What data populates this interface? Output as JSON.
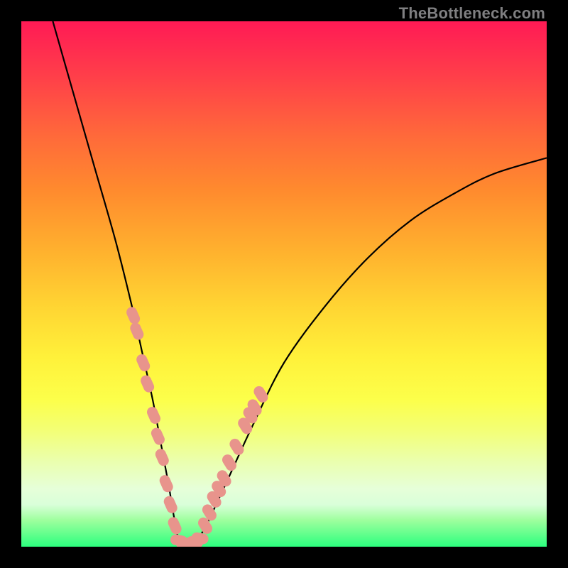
{
  "attribution": "TheBottleneck.com",
  "colors": {
    "frame": "#000000",
    "attribution_text": "#7f7f81",
    "curve": "#000000",
    "dot": "#e8948c",
    "gradient_top": "#ff1a55",
    "gradient_bottom": "#2cff7e"
  },
  "chart_data": {
    "type": "line",
    "title": "",
    "xlabel": "",
    "ylabel": "",
    "xlim": [
      0,
      100
    ],
    "ylim": [
      0,
      100
    ],
    "grid": false,
    "legend": false,
    "series": [
      {
        "name": "bottleneck-curve",
        "x": [
          6,
          10,
          14,
          18,
          21,
          23,
          25,
          26.5,
          28,
          29,
          30,
          31,
          34,
          38,
          44,
          50,
          58,
          66,
          74,
          82,
          90,
          100
        ],
        "values": [
          100,
          86,
          72,
          58,
          46,
          37,
          28,
          20,
          12,
          6,
          1,
          0,
          2,
          10,
          23,
          35,
          46,
          55,
          62,
          67,
          71,
          74
        ]
      }
    ],
    "highlighted_points_left": [
      {
        "x": 21.3,
        "y": 44
      },
      {
        "x": 22.0,
        "y": 41
      },
      {
        "x": 23.2,
        "y": 35
      },
      {
        "x": 24.0,
        "y": 31
      },
      {
        "x": 25.2,
        "y": 25
      },
      {
        "x": 26.0,
        "y": 21
      },
      {
        "x": 26.8,
        "y": 17
      },
      {
        "x": 27.6,
        "y": 12
      },
      {
        "x": 28.4,
        "y": 8
      },
      {
        "x": 29.2,
        "y": 4
      }
    ],
    "highlighted_points_bottom": [
      {
        "x": 30.0,
        "y": 1.2
      },
      {
        "x": 31.0,
        "y": 0.6
      },
      {
        "x": 32.0,
        "y": 0.6
      },
      {
        "x": 33.0,
        "y": 0.9
      },
      {
        "x": 34.0,
        "y": 1.6
      }
    ],
    "highlighted_points_right": [
      {
        "x": 35.0,
        "y": 4
      },
      {
        "x": 35.8,
        "y": 6.5
      },
      {
        "x": 36.7,
        "y": 9
      },
      {
        "x": 37.6,
        "y": 11
      },
      {
        "x": 38.6,
        "y": 13
      },
      {
        "x": 39.6,
        "y": 16
      },
      {
        "x": 41.0,
        "y": 19
      },
      {
        "x": 42.6,
        "y": 23
      },
      {
        "x": 43.6,
        "y": 25
      },
      {
        "x": 44.4,
        "y": 26.5
      },
      {
        "x": 45.6,
        "y": 29
      }
    ],
    "note": "Axes have no visible tick labels; x/y are normalized 0-100 across plot area, values estimated from gridless gradient background."
  }
}
